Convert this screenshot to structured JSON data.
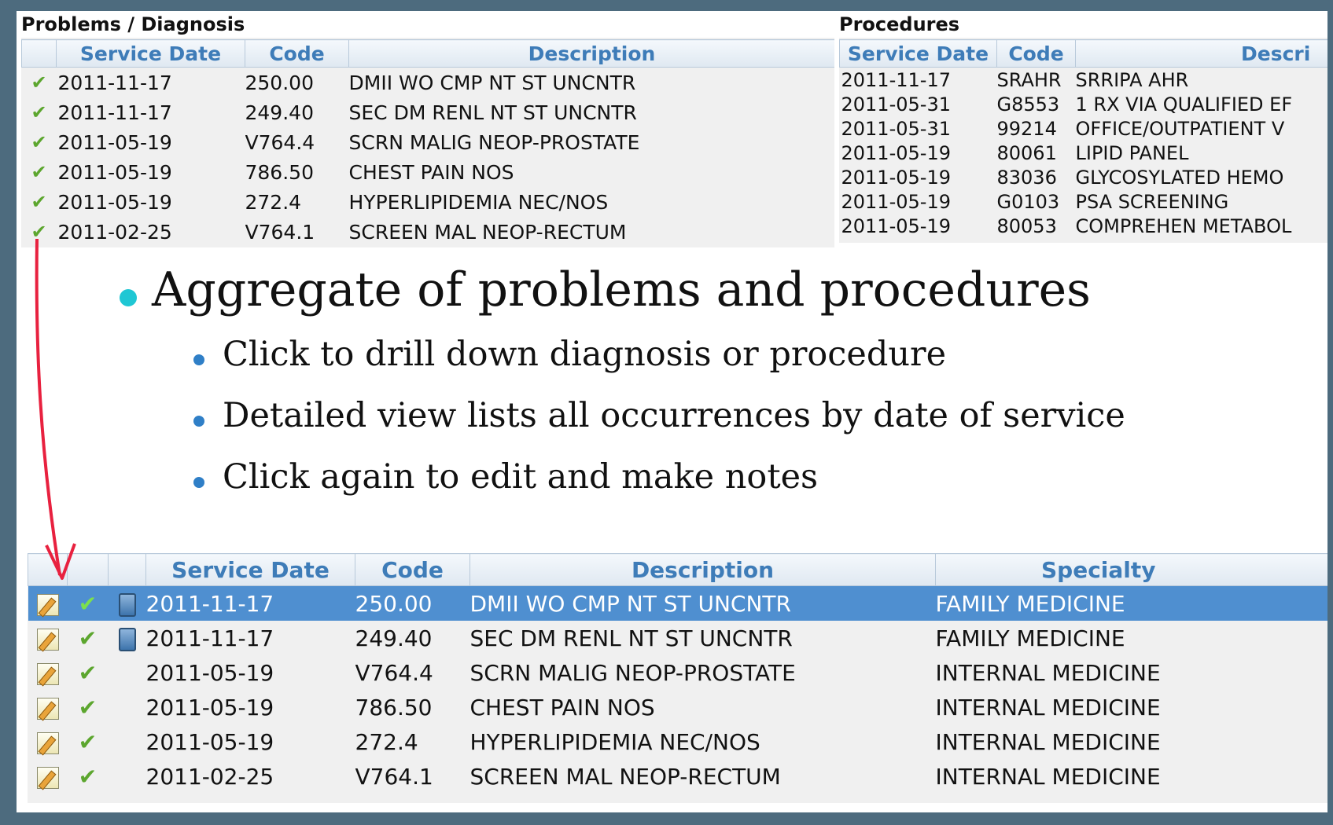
{
  "problems": {
    "title": "Problems / Diagnosis",
    "columns": [
      "Service Date",
      "Code",
      "Description"
    ],
    "rows": [
      {
        "date": "2011-11-17",
        "code": "250.00",
        "desc": "DMII WO CMP NT ST UNCNTR"
      },
      {
        "date": "2011-11-17",
        "code": "249.40",
        "desc": "SEC DM RENL NT ST UNCNTR"
      },
      {
        "date": "2011-05-19",
        "code": "V764.4",
        "desc": "SCRN MALIG NEOP-PROSTATE"
      },
      {
        "date": "2011-05-19",
        "code": "786.50",
        "desc": "CHEST PAIN NOS"
      },
      {
        "date": "2011-05-19",
        "code": "272.4",
        "desc": "HYPERLIPIDEMIA NEC/NOS"
      },
      {
        "date": "2011-02-25",
        "code": "V764.1",
        "desc": "SCREEN MAL NEOP-RECTUM"
      }
    ]
  },
  "procedures": {
    "title": "Procedures",
    "columns": [
      "Service Date",
      "Code",
      "Descri"
    ],
    "rows": [
      {
        "date": "2011-11-17",
        "code": "SRAHR",
        "desc": "SRRIPA AHR"
      },
      {
        "date": "2011-05-31",
        "code": "G8553",
        "desc": "1 RX VIA QUALIFIED EF"
      },
      {
        "date": "2011-05-31",
        "code": "99214",
        "desc": "OFFICE/OUTPATIENT V"
      },
      {
        "date": "2011-05-19",
        "code": "80061",
        "desc": "LIPID PANEL"
      },
      {
        "date": "2011-05-19",
        "code": "83036",
        "desc": "GLYCOSYLATED HEMO"
      },
      {
        "date": "2011-05-19",
        "code": "G0103",
        "desc": "PSA SCREENING"
      },
      {
        "date": "2011-05-19",
        "code": "80053",
        "desc": "COMPREHEN METABOL"
      }
    ]
  },
  "bullets": {
    "main": "Aggregate of problems and procedures",
    "sub": [
      "Click to drill down diagnosis or procedure",
      "Detailed view lists all occurrences by date of service",
      "Click again to edit and make notes"
    ]
  },
  "detail": {
    "columns": [
      "Service Date",
      "Code",
      "Description",
      "Specialty"
    ],
    "rows": [
      {
        "date": "2011-11-17",
        "code": "250.00",
        "desc": "DMII WO CMP NT ST UNCNTR",
        "specialty": "FAMILY MEDICINE",
        "has_doc": true
      },
      {
        "date": "2011-11-17",
        "code": "249.40",
        "desc": "SEC DM RENL NT ST UNCNTR",
        "specialty": "FAMILY MEDICINE",
        "has_doc": true
      },
      {
        "date": "2011-05-19",
        "code": "V764.4",
        "desc": "SCRN MALIG NEOP-PROSTATE",
        "specialty": "INTERNAL MEDICINE",
        "has_doc": false
      },
      {
        "date": "2011-05-19",
        "code": "786.50",
        "desc": "CHEST PAIN NOS",
        "specialty": "INTERNAL MEDICINE",
        "has_doc": false
      },
      {
        "date": "2011-05-19",
        "code": "272.4",
        "desc": "HYPERLIPIDEMIA NEC/NOS",
        "specialty": "INTERNAL MEDICINE",
        "has_doc": false
      },
      {
        "date": "2011-02-25",
        "code": "V764.1",
        "desc": "SCREEN MAL NEOP-RECTUM",
        "specialty": "INTERNAL MEDICINE",
        "has_doc": false
      }
    ],
    "selected_row": 0
  },
  "icons": {
    "check": "checkmark-icon",
    "edit": "edit-note-icon",
    "doc": "document-icon",
    "check_glyph": "✔"
  },
  "colors": {
    "header_text": "#3e7cb8",
    "selected_row": "#4f8fd0",
    "bullet_main": "#1fc7d4",
    "bullet_sub": "#2f7fc7",
    "arrow": "#e8213f"
  }
}
